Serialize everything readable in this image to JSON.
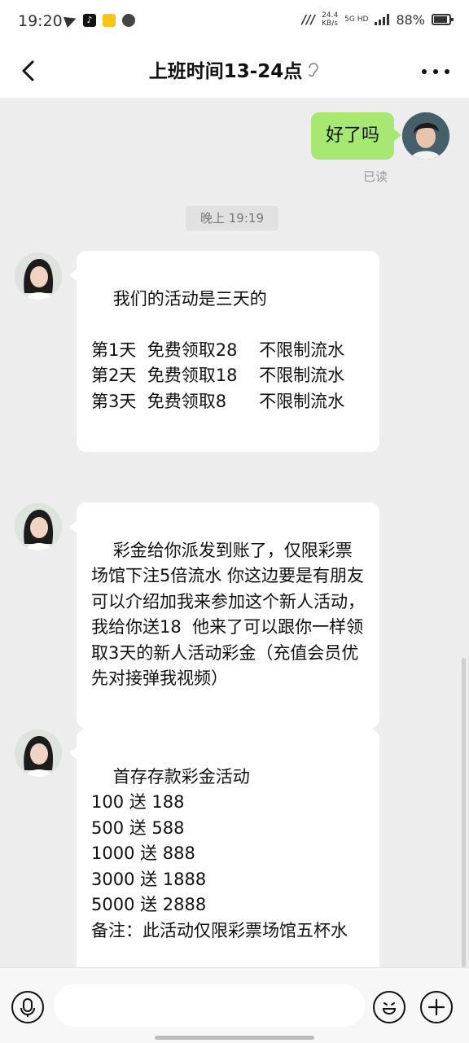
{
  "status_bar": {
    "time": "19:20",
    "net_speed": "24.4",
    "net_unit": "KB/s",
    "signal_label": "5G HD",
    "battery": "88%"
  },
  "header": {
    "title": "上班时间13-24点"
  },
  "chat": {
    "outgoing": {
      "text": "好了吗",
      "read_status": "已读"
    },
    "timestamp": "晚上 19:19",
    "incoming": [
      {
        "text": "我们的活动是三天的\n\n第1天  免费领取28    不限制流水\n第2天  免费领取18    不限制流水\n第3天  免费领取8      不限制流水"
      },
      {
        "text": "彩金给你派发到账了，仅限彩票场馆下注5倍流水 你这边要是有朋友可以介绍加我来参加这个新人活动，我给你送18  他来了可以跟你一样领取3天的新人活动彩金（充值会员优先对接弹我视频）"
      },
      {
        "text": "首存存款彩金活动\n100 送 188\n500 送 588\n1000 送 888\n3000 送 1888\n5000 送 2888\n备注：此活动仅限彩票场馆五杯水"
      }
    ]
  },
  "input": {
    "placeholder": ""
  },
  "colors": {
    "outgoing_bubble": "#a7e873",
    "incoming_bubble": "#ffffff",
    "background": "#ededed"
  }
}
